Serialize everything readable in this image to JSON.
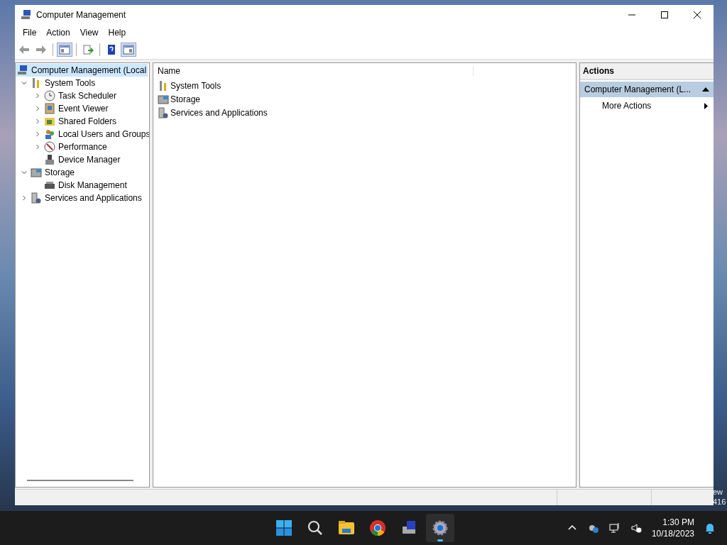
{
  "window": {
    "title": "Computer Management"
  },
  "menu": [
    "File",
    "Action",
    "View",
    "Help"
  ],
  "toolbar": [
    {
      "kind": "back",
      "disabled": true
    },
    {
      "kind": "forward",
      "disabled": true
    },
    {
      "kind": "sep"
    },
    {
      "kind": "tree",
      "pressed": true
    },
    {
      "kind": "sep"
    },
    {
      "kind": "export",
      "pressed": false
    },
    {
      "kind": "sep"
    },
    {
      "kind": "help",
      "pressed": false
    },
    {
      "kind": "panel",
      "pressed": true
    }
  ],
  "tree": [
    {
      "label": "Computer Management (Local",
      "selected": true,
      "children": [
        {
          "label": "System Tools",
          "expanded": true,
          "selected": false,
          "children": [
            {
              "label": "Task Scheduler",
              "expanded": false,
              "selected": false
            },
            {
              "label": "Event Viewer",
              "expanded": false,
              "selected": false
            },
            {
              "label": "Shared Folders",
              "expanded": false,
              "selected": false
            },
            {
              "label": "Local Users and Groups",
              "expanded": false,
              "selected": false
            },
            {
              "label": "Performance",
              "expanded": false,
              "selected": false
            },
            {
              "label": "Device Manager",
              "selected": false
            }
          ]
        },
        {
          "label": "Storage",
          "expanded": true,
          "selected": false,
          "children": [
            {
              "label": "Disk Management",
              "selected": false
            }
          ]
        },
        {
          "label": "Services and Applications",
          "expanded": false,
          "selected": false
        }
      ]
    }
  ],
  "list": {
    "columns": [
      "Name"
    ],
    "rows": [
      "System Tools",
      "Storage",
      "Services and Applications"
    ]
  },
  "actions": {
    "title": "Actions",
    "section": {
      "label": "Computer Management (L...",
      "expanded": true
    },
    "items": [
      "More Actions"
    ]
  },
  "desktop_text": [
    "ew",
    "416"
  ],
  "taskbar": {
    "apps": [
      {
        "kind": "start",
        "active": false
      },
      {
        "kind": "search",
        "active": false
      },
      {
        "kind": "explorer",
        "active": false
      },
      {
        "kind": "chrome",
        "active": false
      },
      {
        "kind": "compmgmt",
        "active": false
      },
      {
        "kind": "settings",
        "active": true
      }
    ],
    "tray": [
      {
        "kind": "caret"
      },
      {
        "kind": "cloud"
      },
      {
        "kind": "network"
      },
      {
        "kind": "muted"
      }
    ],
    "time": "1:30 PM",
    "date": "10/18/2023"
  }
}
